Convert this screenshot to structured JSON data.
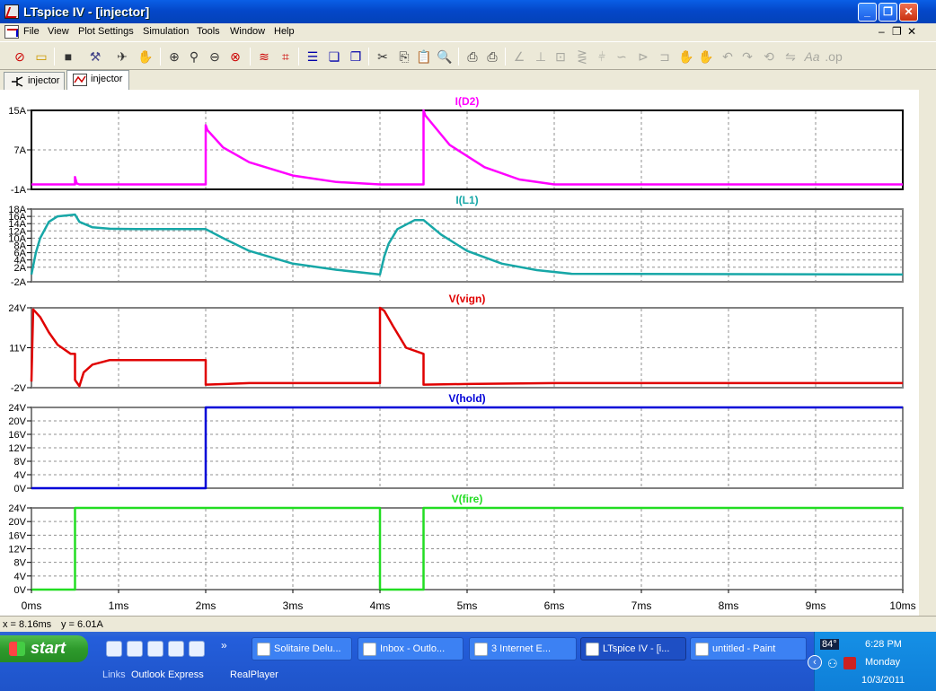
{
  "window": {
    "title": "LTspice IV - [injector]",
    "controls": [
      "_",
      "❐",
      "✕"
    ]
  },
  "menu": {
    "items": [
      "File",
      "View",
      "Plot Settings",
      "Simulation",
      "Tools",
      "Window",
      "Help"
    ],
    "mdi_controls": [
      "–",
      "❐",
      "✕"
    ]
  },
  "toolbar": {
    "icons": [
      "open-new-schematic-icon",
      "open-folder-icon",
      "save-icon",
      "control-panel-icon",
      "run-icon",
      "halt-icon",
      "zoom-area-icon",
      "zoom-in-icon",
      "zoom-out-icon",
      "zoom-cancel-icon",
      "autorange-icon",
      "fit-icon",
      "tile-horizontal-icon",
      "cascade-icon",
      "tile-vertical-icon",
      "cut-icon",
      "copy-icon",
      "paste-icon",
      "find-icon",
      "print-setup-icon",
      "print-icon",
      "draw-wire-icon",
      "ground-icon",
      "label-net-icon",
      "resistor-icon",
      "capacitor-icon",
      "inductor-icon",
      "diode-icon",
      "component-icon",
      "move-icon",
      "drag-icon",
      "undo-icon",
      "redo-icon",
      "rotate-icon",
      "mirror-icon",
      "text-icon",
      "spice-directive-icon"
    ]
  },
  "tabs": [
    {
      "label": "injector",
      "kind": "schematic"
    },
    {
      "label": "injector",
      "kind": "waveform",
      "active": true
    }
  ],
  "chart_data": [
    {
      "type": "line",
      "title": "I(D2)",
      "color": "#ff00ff",
      "ylim": [
        -1,
        15
      ],
      "yticks": [
        "15A",
        "7A",
        "-1A"
      ],
      "series": [
        {
          "name": "I(D2)",
          "x": [
            0,
            0.5,
            0.5,
            0.52,
            0.55,
            2.0,
            2.0,
            2.02,
            2.2,
            2.5,
            3.0,
            3.5,
            4.0,
            4.5,
            4.5,
            4.52,
            4.8,
            5.2,
            5.6,
            6.0,
            10.0
          ],
          "values": [
            0,
            0,
            1.5,
            0.2,
            0,
            0,
            12,
            11,
            7.5,
            4.5,
            1.8,
            0.5,
            0,
            0,
            15,
            14,
            8,
            3.5,
            1,
            0,
            0
          ]
        }
      ]
    },
    {
      "type": "line",
      "title": "I(L1)",
      "color": "#17a7a7",
      "ylim": [
        -2,
        18
      ],
      "yticks": [
        "18A",
        "16A",
        "14A",
        "12A",
        "10A",
        "8A",
        "6A",
        "4A",
        "2A",
        "-2A"
      ],
      "series": [
        {
          "name": "I(L1)",
          "x": [
            0,
            0.05,
            0.1,
            0.2,
            0.3,
            0.5,
            0.55,
            0.7,
            0.9,
            1.2,
            2.0,
            2.2,
            2.5,
            3.0,
            3.5,
            4.0,
            4.05,
            4.1,
            4.2,
            4.4,
            4.5,
            4.7,
            5.0,
            5.4,
            5.8,
            6.2,
            10.0
          ],
          "values": [
            0,
            6,
            10,
            14.5,
            16,
            16.5,
            14.5,
            13,
            12.6,
            12.5,
            12.5,
            10,
            6.5,
            3,
            1.3,
            0,
            5,
            8.5,
            12.5,
            15,
            15,
            11,
            6.5,
            3,
            1.2,
            0.2,
            0
          ]
        }
      ]
    },
    {
      "type": "line",
      "title": "V(vign)",
      "color": "#e00000",
      "ylim": [
        -2,
        24
      ],
      "yticks": [
        "24V",
        "11V",
        "-2V"
      ],
      "series": [
        {
          "name": "V(vign)",
          "x": [
            0,
            0.02,
            0.1,
            0.2,
            0.3,
            0.45,
            0.5,
            0.5,
            0.55,
            0.6,
            0.7,
            0.9,
            1.2,
            2.0,
            2.0,
            2.5,
            3.0,
            4.0,
            4.0,
            4.05,
            4.15,
            4.3,
            4.5,
            4.5,
            5.0,
            6.0,
            10.0
          ],
          "values": [
            0,
            23.5,
            21,
            16,
            12,
            9,
            9,
            0.5,
            -1.5,
            3,
            5.5,
            7,
            7,
            7,
            -1,
            -0.5,
            -0.5,
            -0.5,
            24,
            23,
            18,
            11,
            9,
            -1,
            -0.8,
            -0.5,
            -0.5
          ]
        }
      ]
    },
    {
      "type": "line",
      "title": "V(hold)",
      "color": "#0000d8",
      "ylim": [
        0,
        24
      ],
      "yticks": [
        "24V",
        "20V",
        "16V",
        "12V",
        "8V",
        "4V",
        "0V"
      ],
      "series": [
        {
          "name": "V(hold)",
          "x": [
            0,
            2.0,
            2.0,
            10.0
          ],
          "values": [
            0,
            0,
            24,
            24
          ]
        }
      ]
    },
    {
      "type": "line",
      "title": "V(fire)",
      "color": "#22dd22",
      "ylim": [
        0,
        24
      ],
      "yticks": [
        "24V",
        "20V",
        "16V",
        "12V",
        "8V",
        "4V",
        "0V"
      ],
      "xticks": [
        "0ms",
        "1ms",
        "2ms",
        "3ms",
        "4ms",
        "5ms",
        "6ms",
        "7ms",
        "8ms",
        "9ms",
        "10ms"
      ],
      "xlim": [
        0,
        10
      ],
      "series": [
        {
          "name": "V(fire)",
          "x": [
            0,
            0.5,
            0.5,
            4.0,
            4.0,
            4.5,
            4.5,
            10.0
          ],
          "values": [
            0,
            0,
            24,
            24,
            0,
            0,
            24,
            24
          ]
        }
      ]
    }
  ],
  "status": {
    "cursor_x": "x = 8.16ms",
    "cursor_y": "y = 6.01A"
  },
  "taskbar": {
    "start_label": "start",
    "tasks": [
      {
        "label": "Solitaire Delu...",
        "active": false
      },
      {
        "label": "Inbox - Outlo...",
        "active": false
      },
      {
        "label": "3 Internet E...",
        "active": false
      },
      {
        "label": "LTspice IV - [i...",
        "active": true
      },
      {
        "label": "untitled - Paint",
        "active": false
      }
    ],
    "links_label": "Links",
    "links": [
      "Outlook Express",
      "RealPlayer"
    ],
    "chevron": "»",
    "tray": {
      "temp": "84°",
      "time": "6:28 PM",
      "day": "Monday",
      "date": "10/3/2011"
    }
  }
}
